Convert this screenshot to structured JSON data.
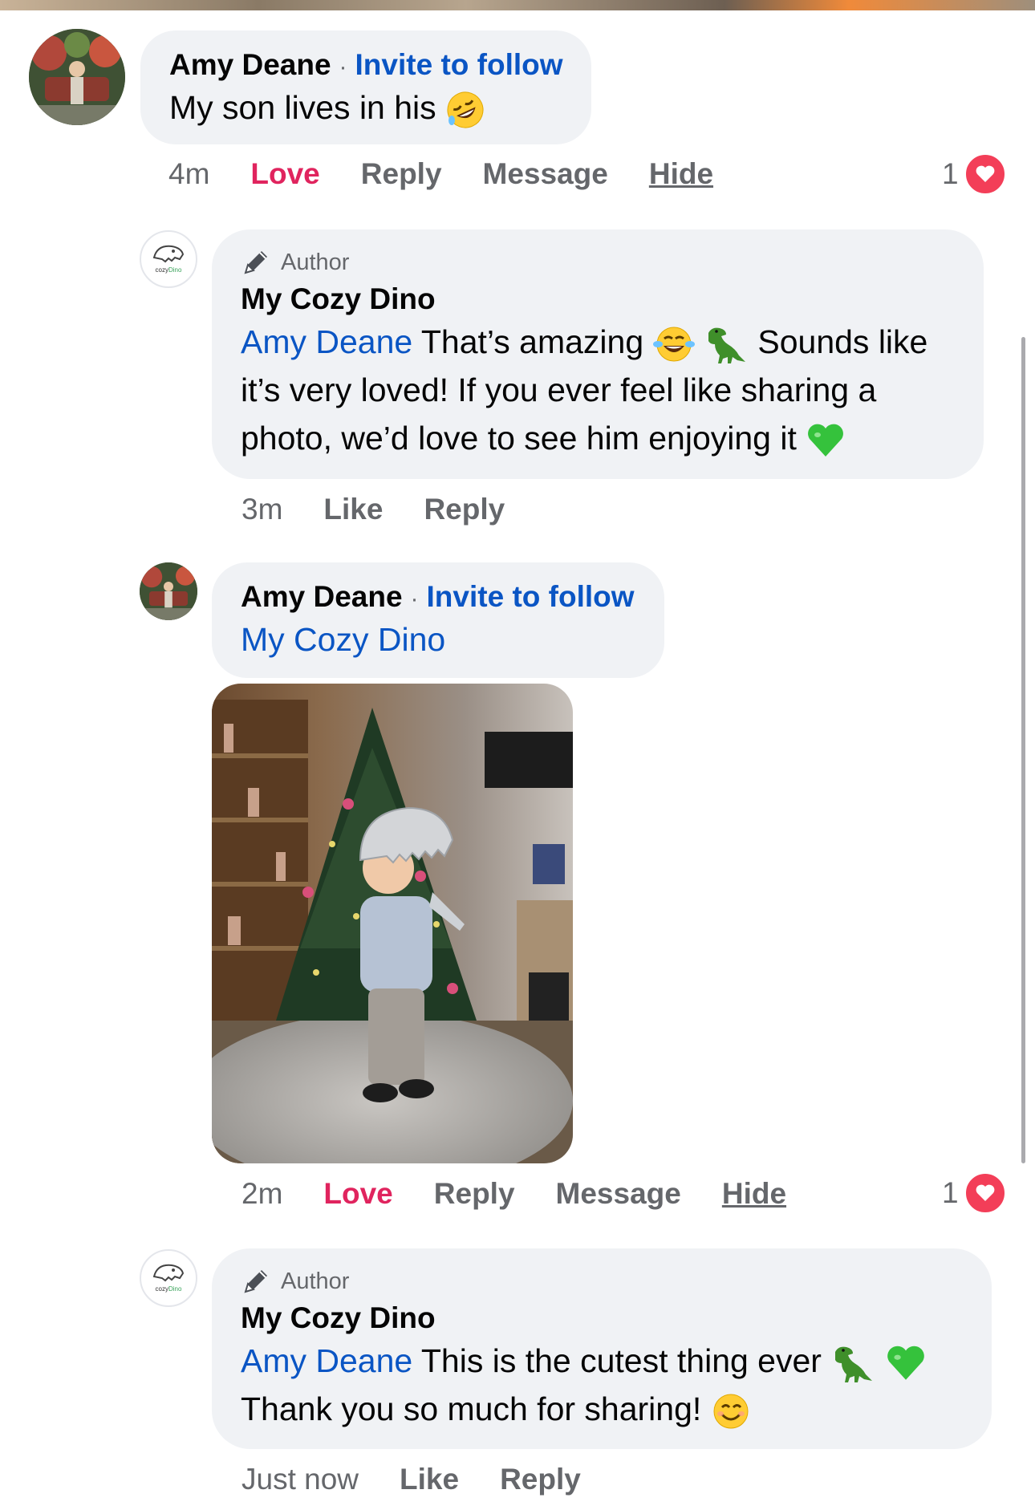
{
  "comments": [
    {
      "author": "Amy Deane",
      "invite": "Invite to follow",
      "text": "My son lives in his",
      "time": "4m",
      "actions": {
        "love": "Love",
        "reply": "Reply",
        "message": "Message",
        "hide": "Hide"
      },
      "reaction_count": "1"
    },
    {
      "badge": "Author",
      "author": "My Cozy Dino",
      "mention": "Amy Deane",
      "text_1": "That’s amazing",
      "text_2": "Sounds like",
      "text_3": "it’s very loved! If you ever feel like sharing a",
      "text_4": "photo, we’d love to see him enjoying it",
      "time": "3m",
      "actions": {
        "like": "Like",
        "reply": "Reply"
      }
    },
    {
      "author": "Amy Deane",
      "invite": "Invite to follow",
      "mention": "My Cozy Dino",
      "time": "2m",
      "actions": {
        "love": "Love",
        "reply": "Reply",
        "message": "Message",
        "hide": "Hide"
      },
      "reaction_count": "1"
    },
    {
      "badge": "Author",
      "author": "My Cozy Dino",
      "mention": "Amy Deane",
      "text_1": "This is the cutest thing ever",
      "text_2": "Thank you so much for sharing!",
      "time": "Just now",
      "actions": {
        "like": "Like",
        "reply": "Reply"
      }
    }
  ],
  "logo_text": "cozyDino",
  "icons": {
    "author": "pencil-icon",
    "reaction": "heart-icon",
    "emojis": [
      "rofl-emoji",
      "joy-emoji",
      "t-rex-emoji",
      "green-heart-emoji",
      "smiling-emoji"
    ]
  },
  "colors": {
    "link": "#0a55c4",
    "love": "#e0245e",
    "bubble": "#f0f2f5",
    "heart": "#f33e58"
  }
}
